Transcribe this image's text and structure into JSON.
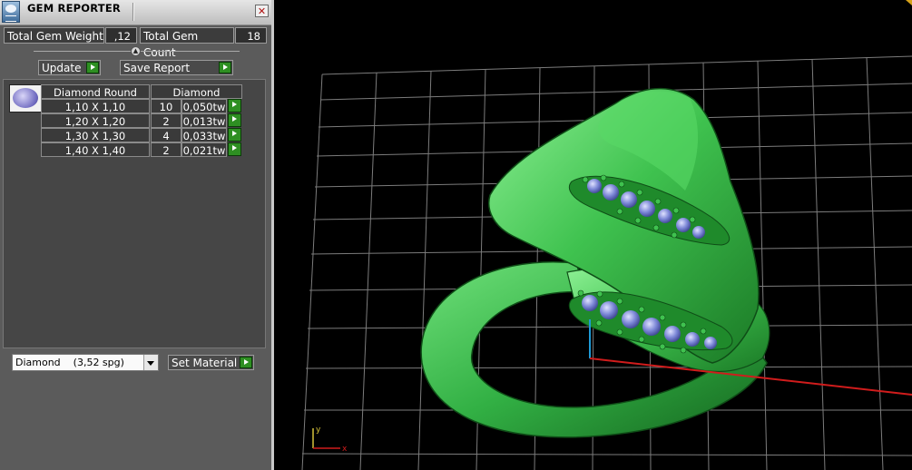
{
  "window": {
    "title": "GEM REPORTER",
    "close_glyph": "✕",
    "icon": "gem-reporter-app-icon"
  },
  "summary": {
    "weight_label": "Total Gem Weight",
    "weight_value": ",12",
    "count_label": "Total Gem Count",
    "count_value": "18"
  },
  "toolbar": {
    "update_label": "Update",
    "save_label": "Save Report"
  },
  "gem_table": {
    "headers": [
      "Diamond Round",
      "Diamond"
    ],
    "rows": [
      {
        "size": "1,10 X 1,10",
        "count": "10",
        "weight": "0,050tw"
      },
      {
        "size": "1,20 X 1,20",
        "count": "2",
        "weight": "0,013tw"
      },
      {
        "size": "1,30 X 1,30",
        "count": "4",
        "weight": "0,033tw"
      },
      {
        "size": "1,40 X 1,40",
        "count": "2",
        "weight": "0,021tw"
      }
    ]
  },
  "material": {
    "selected": "Diamond    (3,52 spg)",
    "set_label": "Set Material"
  },
  "colors": {
    "accent_green": "#2e8f22",
    "model_green": "#3cc04a",
    "stone_blue": "#7b86d6",
    "grid": "#8a8a8a",
    "x_axis": "#d01c1c",
    "y_axis": "#1e9ad6"
  },
  "viewport": {
    "axis_x_label": "x",
    "axis_y_label": "y"
  }
}
